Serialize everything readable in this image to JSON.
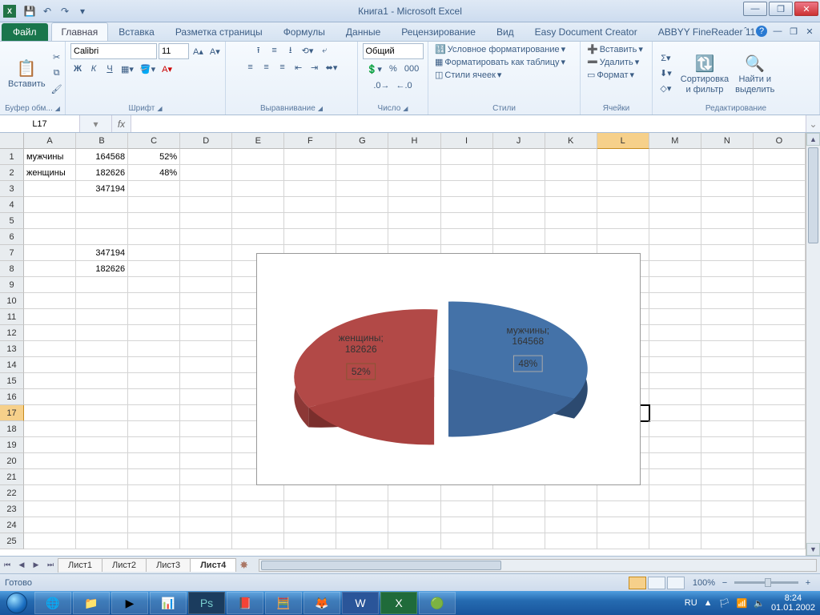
{
  "title": "Книга1  -  Microsoft Excel",
  "qat": {
    "save": "💾",
    "undo": "↶",
    "redo": "↷"
  },
  "window_controls": {
    "min": "—",
    "max": "❐",
    "close": "✕",
    "excel_min": "—",
    "excel_restore": "❐",
    "excel_close": "✕"
  },
  "file_tab": "Файл",
  "tabs": [
    "Главная",
    "Вставка",
    "Разметка страницы",
    "Формулы",
    "Данные",
    "Рецензирование",
    "Вид",
    "Easy Document Creator",
    "ABBYY FineReader 11"
  ],
  "active_tab": 0,
  "ribbon": {
    "clipboard": {
      "paste": "Вставить",
      "label": "Буфер обм..."
    },
    "font": {
      "name": "Calibri",
      "size": "11",
      "bold": "Ж",
      "italic": "К",
      "underline": "Ч",
      "label": "Шрифт"
    },
    "align": {
      "label": "Выравнивание"
    },
    "number": {
      "format": "Общий",
      "label": "Число"
    },
    "styles": {
      "cond": "Условное форматирование",
      "table": "Форматировать как таблицу",
      "cell": "Стили ячеек",
      "label": "Стили"
    },
    "cells": {
      "insert": "Вставить",
      "delete": "Удалить",
      "format": "Формат",
      "label": "Ячейки"
    },
    "editing": {
      "sort": "Сортировка\nи фильтр",
      "find": "Найти и\nвыделить",
      "label": "Редактирование"
    }
  },
  "namebox": "L17",
  "formula": "",
  "columns": [
    "A",
    "B",
    "C",
    "D",
    "E",
    "F",
    "G",
    "H",
    "I",
    "J",
    "K",
    "L",
    "M",
    "N",
    "O"
  ],
  "rows": 25,
  "cells": {
    "A1": "мужчины",
    "B1": "164568",
    "C1": "52%",
    "A2": "женщины",
    "B2": "182626",
    "C2": "48%",
    "B3": "347194",
    "B7": "347194",
    "B8": "182626"
  },
  "selected_cell": "L17",
  "sheets": [
    "Лист1",
    "Лист2",
    "Лист3",
    "Лист4"
  ],
  "active_sheet": 3,
  "status_text": "Готово",
  "zoom_label": "100%",
  "taskbar_lang": "RU",
  "clock_time": "8:24",
  "clock_date": "01.01.2002",
  "help_icons": {
    "up": "ˆ",
    "help": "?"
  },
  "chart_data": {
    "type": "pie",
    "title": "",
    "series": [
      {
        "name": "мужчины",
        "value": 164568,
        "percent_label": "48%",
        "color": "#4472a8"
      },
      {
        "name": "женщины",
        "value": 182626,
        "percent_label": "52%",
        "color": "#b24947"
      }
    ],
    "labels": {
      "men": "мужчины;\n164568",
      "women": "женщины;\n182626"
    },
    "exploded": true,
    "three_d": true
  }
}
